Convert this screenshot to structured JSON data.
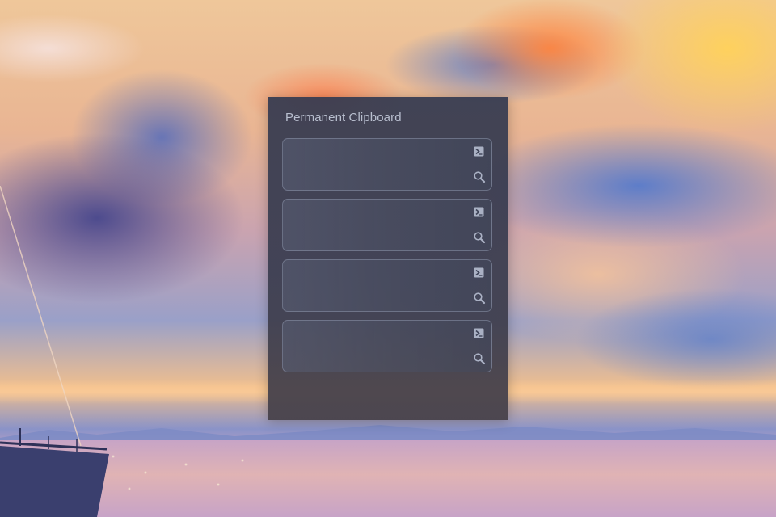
{
  "window": {
    "title": "Permanent Clipboard"
  },
  "slots": [
    {
      "content": "",
      "paste_icon": "terminal-icon",
      "search_icon": "magnifier-icon"
    },
    {
      "content": "",
      "paste_icon": "terminal-icon",
      "search_icon": "magnifier-icon"
    },
    {
      "content": "",
      "paste_icon": "terminal-icon",
      "search_icon": "magnifier-icon"
    },
    {
      "content": "",
      "paste_icon": "terminal-icon",
      "search_icon": "magnifier-icon"
    }
  ],
  "colors": {
    "panel_background": "#3a3e52",
    "title_text": "#b9bfcf",
    "slot_border": "#8c94aa",
    "icon": "#aab1c4"
  }
}
